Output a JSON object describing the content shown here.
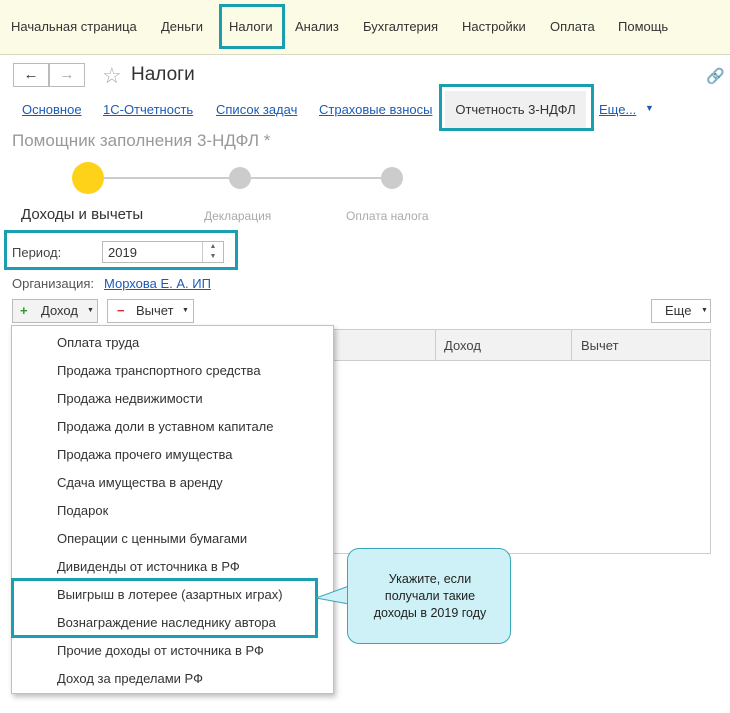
{
  "topbar": {
    "items": [
      "Начальная страница",
      "Деньги",
      "Налоги",
      "Анализ",
      "Бухгалтерия",
      "Настройки",
      "Оплата",
      "Помощь"
    ]
  },
  "header": {
    "back": "←",
    "forward": "→",
    "title": "Налоги"
  },
  "tabs": {
    "items": [
      "Основное",
      "1С-Отчетность",
      "Список задач",
      "Страховые взносы"
    ],
    "active": "Отчетность 3-НДФЛ",
    "more": "Еще..."
  },
  "assistant": {
    "title": "Помощник заполнения 3-НДФЛ *",
    "steps": [
      "Доходы и вычеты",
      "Декларация",
      "Оплата налога"
    ]
  },
  "form": {
    "period_label": "Период:",
    "period_value": "2019",
    "org_label": "Организация:",
    "org_value": "Морхова Е. А. ИП"
  },
  "toolbar": {
    "income": "Доход",
    "deduction": "Вычет",
    "more": "Еще"
  },
  "table": {
    "columns": [
      "Доход",
      "Вычет"
    ]
  },
  "menu": {
    "items": [
      "Оплата труда",
      "Продажа транспортного средства",
      "Продажа недвижимости",
      "Продажа доли в уставном капитале",
      "Продажа прочего имущества",
      "Сдача имущества в аренду",
      "Подарок",
      "Операции с ценными бумагами",
      "Дивиденды от источника в РФ",
      "Выигрыш в лотерее (азартных играх)",
      "Вознаграждение наследнику автора",
      "Прочие доходы от источника в РФ",
      "Доход за пределами РФ"
    ]
  },
  "callout": {
    "text": "Укажите, если\nполучали такие\nдоходы в 2019 году"
  },
  "colors": {
    "highlight": "#1a9fb0",
    "active_step": "#ffd21a",
    "link": "#1c5bb5",
    "topbar_bg": "#fbfbe6",
    "callout_bg": "#cdf1f6"
  }
}
